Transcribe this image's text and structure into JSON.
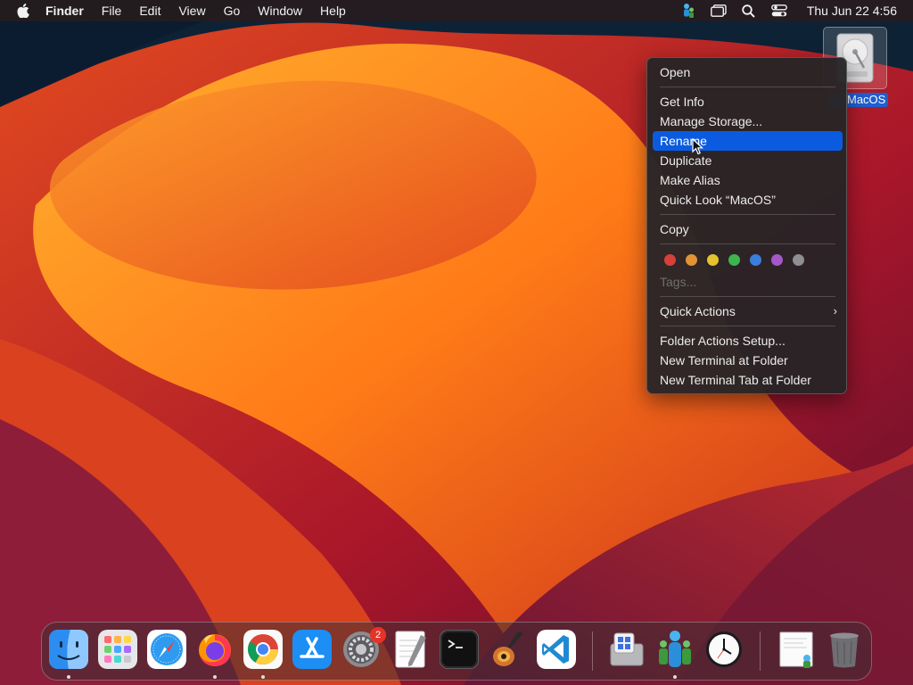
{
  "menubar": {
    "app_name": "Finder",
    "items": [
      "File",
      "Edit",
      "View",
      "Go",
      "Window",
      "Help"
    ],
    "clock": "Thu Jun 22  4:56",
    "status_icons": [
      "network-person-icon",
      "screen-mirroring-icon",
      "spotlight-search-icon",
      "control-center-icon"
    ]
  },
  "desktop": {
    "disk_label": "MacOS",
    "disk_icon": "hard-drive-icon"
  },
  "context_menu": {
    "items": [
      {
        "label": "Open"
      },
      {
        "label": "Get Info"
      },
      {
        "label": "Manage Storage..."
      },
      {
        "label": "Rename",
        "selected": true
      },
      {
        "label": "Duplicate"
      },
      {
        "label": "Make Alias"
      },
      {
        "label": "Quick Look “MacOS”"
      },
      {
        "label": "Copy"
      },
      {
        "label": "Tags...",
        "disabled": true
      },
      {
        "label": "Quick Actions",
        "submenu": true
      },
      {
        "label": "Folder Actions Setup..."
      },
      {
        "label": "New Terminal at Folder"
      },
      {
        "label": "New Terminal Tab at Folder"
      }
    ],
    "submenu_arrow": "›",
    "tag_colors": [
      "#d7403a",
      "#e09436",
      "#e6c22e",
      "#3eb54f",
      "#3a7fdc",
      "#a458c8",
      "#8e8e93"
    ]
  },
  "dock": {
    "apps": [
      {
        "name": "finder-icon",
        "running": true
      },
      {
        "name": "launchpad-icon",
        "running": false
      },
      {
        "name": "safari-icon",
        "running": false
      },
      {
        "name": "firefox-icon",
        "running": true
      },
      {
        "name": "chrome-icon",
        "running": true
      },
      {
        "name": "app-store-icon",
        "running": false
      },
      {
        "name": "system-settings-icon",
        "running": false,
        "badge": "2"
      },
      {
        "name": "textedit-icon",
        "running": false
      },
      {
        "name": "terminal-icon",
        "running": false
      },
      {
        "name": "garageband-icon",
        "running": false
      },
      {
        "name": "vscode-icon",
        "running": false
      },
      {
        "name": "boot-camp-assistant-icon",
        "running": false
      },
      {
        "name": "network-people-icon",
        "running": true
      },
      {
        "name": "clock-icon",
        "running": false
      },
      {
        "name": "document-stack-icon",
        "running": false
      },
      {
        "name": "trash-icon",
        "running": false
      }
    ],
    "settings_badge": "2"
  }
}
